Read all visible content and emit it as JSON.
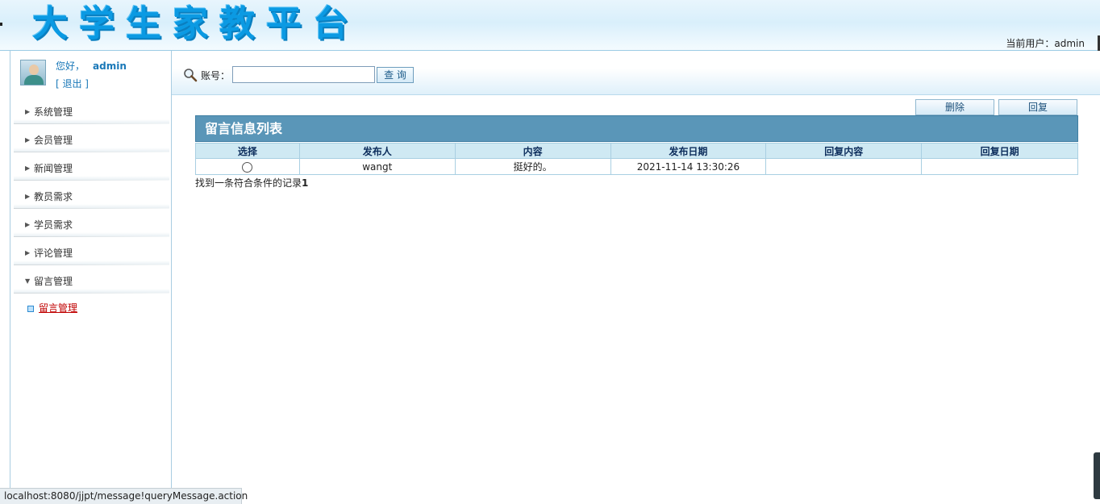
{
  "header": {
    "title": "大学生家教平台",
    "current_user_label": "当前用户：admin"
  },
  "sidebar": {
    "greeting": "您好，",
    "username": "admin",
    "logout": "[ 退出 ]",
    "menu": [
      {
        "label": "系统管理",
        "expanded": false
      },
      {
        "label": "会员管理",
        "expanded": false
      },
      {
        "label": "新闻管理",
        "expanded": false
      },
      {
        "label": "教员需求",
        "expanded": false
      },
      {
        "label": "学员需求",
        "expanded": false
      },
      {
        "label": "评论管理",
        "expanded": false
      },
      {
        "label": "留言管理",
        "expanded": true
      }
    ],
    "submenu": {
      "label": "留言管理"
    }
  },
  "search": {
    "label": "账号：",
    "value": "",
    "button": "查 询"
  },
  "actions": {
    "delete": "删除",
    "reply": "回复"
  },
  "list": {
    "title": "留言信息列表",
    "columns": [
      "选择",
      "发布人",
      "内容",
      "发布日期",
      "回复内容",
      "回复日期"
    ],
    "rows": [
      {
        "publisher": "wangt",
        "content": "挺好的。",
        "date": "2021-11-14 13:30:26",
        "reply_content": "",
        "reply_date": ""
      }
    ],
    "count_text": "找到一条符合条件的记录",
    "count": "1"
  },
  "status_bar": {
    "url": "localhost:8080/jjpt/message!queryMessage.action"
  },
  "colors": {
    "title_blue": "#0b9ae3",
    "list_header": "#5a96b8",
    "link_red": "#c00000"
  }
}
